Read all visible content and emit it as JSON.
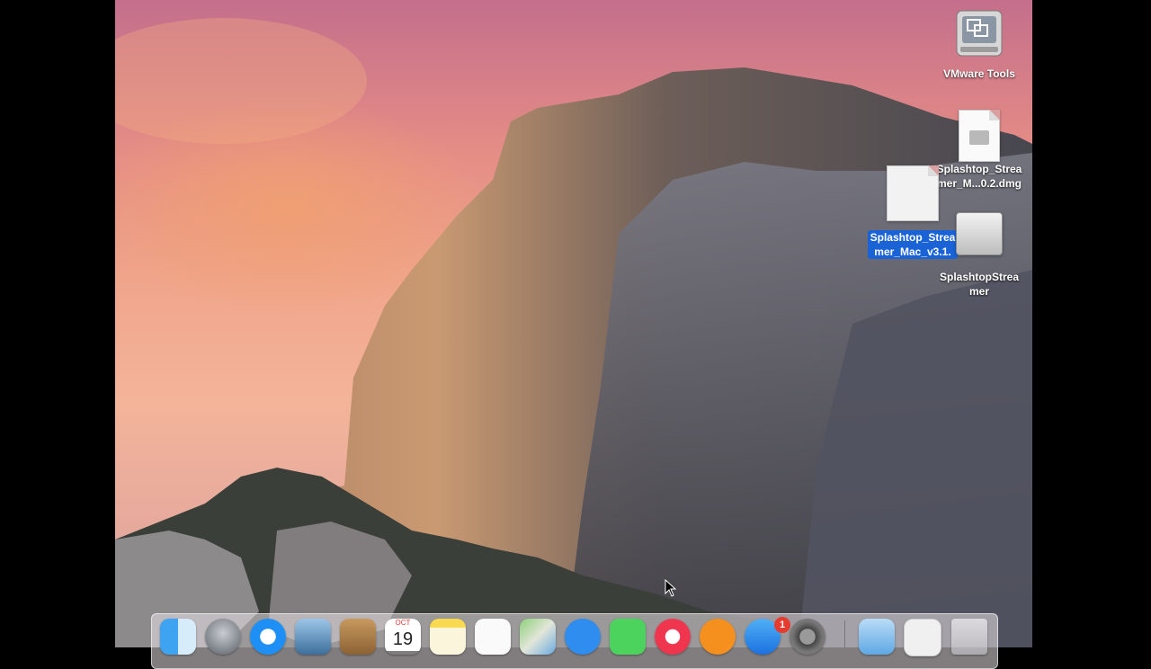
{
  "desktop": {
    "icons": [
      {
        "name": "vmware-tools",
        "label": "VMware Tools"
      },
      {
        "name": "splashtop-dmg",
        "label": "Splashtop_Strea\nmer_M...0.2.dmg"
      },
      {
        "name": "splashtop-mac-dragging",
        "label": "Splashtop_Strea\nmer_Mac_v3.1."
      },
      {
        "name": "splashtop-streamer-volume",
        "label": "SplashtopStrea\nmer"
      }
    ]
  },
  "dock": {
    "items": [
      "Finder",
      "Launchpad",
      "Safari",
      "Mail",
      "Contacts",
      "Calendar",
      "Notes",
      "Reminders",
      "Maps",
      "Messages",
      "FaceTime",
      "iTunes",
      "iBooks",
      "App Store",
      "System Preferences",
      "Downloads",
      "Documents",
      "Trash"
    ],
    "calendar_month": "OCT",
    "calendar_day": "19",
    "appstore_badge": "1"
  },
  "colors": {
    "selection": "#1a63d6",
    "badge": "#e63b2e"
  }
}
